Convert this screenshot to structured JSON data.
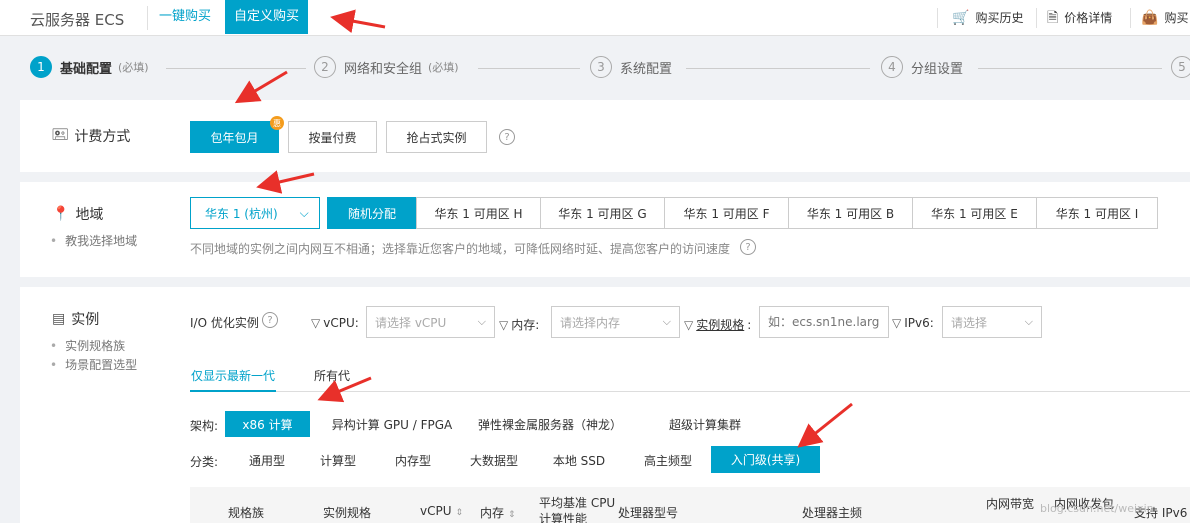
{
  "topbar": {
    "brand": "云服务器 ECS",
    "tabs": [
      "一键购买",
      "自定义购买"
    ],
    "links": [
      {
        "icon": "cart-icon",
        "label": "购买历史"
      },
      {
        "icon": "receipt-icon",
        "label": "价格详情"
      },
      {
        "icon": "bag-icon",
        "label": "购买"
      }
    ]
  },
  "steps": [
    {
      "num": "1",
      "label": "基础配置",
      "req": "(必填)"
    },
    {
      "num": "2",
      "label": "网络和安全组",
      "req": "(必填)"
    },
    {
      "num": "3",
      "label": "系统配置",
      "req": ""
    },
    {
      "num": "4",
      "label": "分组设置",
      "req": ""
    },
    {
      "num": "5",
      "label": "",
      "req": ""
    }
  ],
  "billing": {
    "title": "计费方式",
    "options": [
      "包年包月",
      "按量付费",
      "抢占式实例"
    ],
    "badge": "惠",
    "help": "?"
  },
  "region": {
    "title": "地域",
    "sub_link": "教我选择地域",
    "selected": "华东 1 (杭州)",
    "zones": [
      "随机分配",
      "华东 1 可用区 H",
      "华东 1 可用区 G",
      "华东 1 可用区 F",
      "华东 1 可用区 B",
      "华东 1 可用区 E",
      "华东 1 可用区 I"
    ],
    "hint": "不同地域的实例之间内网互不相通；选择靠近您客户的地域，可降低网络时延、提高您客户的访问速度",
    "help": "?"
  },
  "instance": {
    "title": "实例",
    "sub_links": [
      "实例规格族",
      "场景配置选型"
    ],
    "io_label": "I/O 优化实例",
    "help": "?",
    "filters": {
      "vcpu_label": "vCPU:",
      "vcpu_placeholder": "请选择 vCPU",
      "mem_label": "内存:",
      "mem_placeholder": "请选择内存",
      "spec_label": "实例规格",
      "spec_colon": ":",
      "spec_placeholder": "如：ecs.sn1ne.large",
      "ipv6_label": "IPv6:",
      "ipv6_placeholder": "请选择"
    },
    "gen_tabs": [
      "仅显示最新一代",
      "所有代"
    ],
    "arch_label": "架构:",
    "arch": [
      "x86 计算",
      "异构计算 GPU / FPGA",
      "弹性裸金属服务器（神龙）",
      "超级计算集群"
    ],
    "cat_label": "分类:",
    "categories": [
      "通用型",
      "计算型",
      "内存型",
      "大数据型",
      "本地 SSD",
      "高主频型",
      "入门级(共享)"
    ],
    "table_headers": [
      "规格族",
      "实例规格",
      "vCPU",
      "内存",
      "平均基准 CPU 计算性能",
      "处理器型号",
      "处理器主频",
      "内网带宽",
      "内网收发包",
      "支持 IPv6"
    ]
  },
  "watermark": "blog.csdn.net/weixin"
}
